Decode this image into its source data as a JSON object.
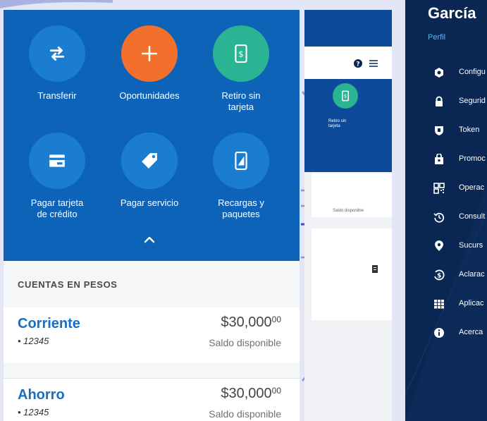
{
  "operations": {
    "items": [
      {
        "label": "Transferir",
        "icon": "transfer-arrows-icon",
        "color": "#1a7dd0"
      },
      {
        "label": "Oportunidades",
        "icon": "plus-icon",
        "color": "#f26f2c"
      },
      {
        "label": "Retiro sin tarjeta",
        "icon": "cash-phone-icon",
        "color": "#2ab493"
      },
      {
        "label": "Pagar tarjeta de crédito",
        "icon": "credit-card-icon",
        "color": "#1a7dd0"
      },
      {
        "label": "Pagar servicio",
        "icon": "tag-icon",
        "color": "#1a7dd0"
      },
      {
        "label": "Recargas y paquetes",
        "icon": "mobile-recharge-icon",
        "color": "#1a7dd0"
      }
    ],
    "collapse_icon": "chevron-up-icon",
    "background": "#0d63b8"
  },
  "accounts": {
    "section_title": "CUENTAS EN PESOS",
    "items": [
      {
        "name": "Corriente",
        "number": "• 12345",
        "amount_main": "$30,000",
        "amount_cents": "00",
        "label": "Saldo disponible"
      },
      {
        "name": "Ahorro",
        "number": "• 12345",
        "amount_main": "$30,000",
        "amount_cents": "00",
        "label": "Saldo disponible"
      }
    ]
  },
  "middle_screen": {
    "retiro_label": "Retiro sin tarjeta",
    "card_text": "Saldo disponible"
  },
  "menu": {
    "user_name": "García",
    "profile_link": "Perfil",
    "items": [
      {
        "label": "Configu",
        "icon": "gear-icon"
      },
      {
        "label": "Segurid",
        "icon": "lock-icon"
      },
      {
        "label": "Token",
        "icon": "shield-icon"
      },
      {
        "label": "Promoc",
        "icon": "gift-icon"
      },
      {
        "label": "Operac",
        "icon": "qr-code-icon"
      },
      {
        "label": "Consult",
        "icon": "history-icon"
      },
      {
        "label": "Sucurs",
        "icon": "location-pin-icon"
      },
      {
        "label": "Aclarac",
        "icon": "dollar-refresh-icon"
      },
      {
        "label": "Aplicac",
        "icon": "apps-grid-icon"
      },
      {
        "label": "Acerca",
        "icon": "info-icon"
      }
    ]
  }
}
